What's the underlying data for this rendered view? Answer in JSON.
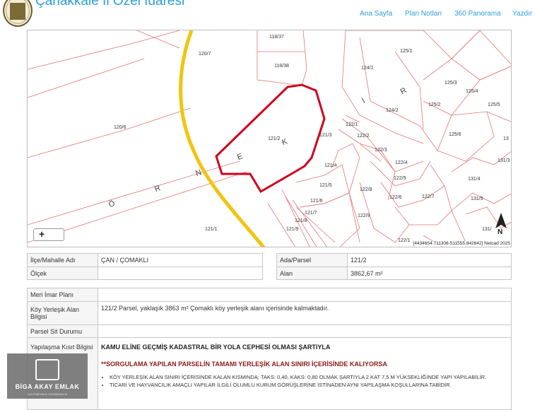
{
  "header": {
    "site_title": "Çanakkale İl Özel İdaresi",
    "nav": [
      "Ana Sayfa",
      "Plan Notları",
      "360 Panorama",
      "Yazdır"
    ]
  },
  "map": {
    "parcel_labels": [
      "118/37",
      "118/38",
      "120/7",
      "120/6",
      "125/1",
      "124/1",
      "125/3",
      "125/4",
      "125/2",
      "125/5",
      "124/2",
      "121/2",
      "121/3",
      "122/1",
      "122/2",
      "122/3",
      "122/4",
      "122/5",
      "121/4",
      "121/5",
      "121/6",
      "121/7",
      "121/8",
      "121/9",
      "121/1",
      "122/6",
      "122/7",
      "122/8",
      "122/9",
      "131/4",
      "131/5",
      "131/3",
      "125/6",
      "13",
      "131/",
      "122/1"
    ],
    "road_letters": [
      "Ö",
      "R",
      "N",
      "E",
      "K",
      "İ",
      "R"
    ],
    "zoom_in": "+",
    "coords": "[4434654.711308-511555.842642] Netcad 2025",
    "north_label": "N",
    "parcel_highlight_color": "#d0021b",
    "road_color": "#f2c40f",
    "parcel_line_color": "#e57373"
  },
  "info_left": {
    "district_label": "İlçe/Mahalle Adı",
    "district_value": "ÇAN / ÇOMAKLI",
    "scale_label": "Ölçek",
    "scale_value": ""
  },
  "info_right": {
    "parcel_label": "Ada/Parsel",
    "parcel_value": "121/2",
    "area_label": "Alan",
    "area_value": "3862,67 m²"
  },
  "plan": {
    "meri_label": "Meri İmar Planı",
    "meri_value": "",
    "koy_label": "Köy Yerleşik Alan Bilgisi",
    "koy_value": "121/2 Parsel, yaklaşık 3863 m² Çomaklı köy yerleşik alanı içerisinde kalmaktadır.",
    "sit_label": "Parsel Sit Durumu",
    "sit_value": "",
    "kisit_label": "Yapılaşma Kısıt Bilgisi",
    "kisit_title": "KAMU ELİNE GEÇMİŞ KADASTRAL BİR YOLA CEPHESİ OLMASI ŞARTIYLA",
    "kisit_warning": "**SORGULAMA YAPILAN PARSELİN TAMAMI YERLEŞİK ALAN SINIRI İÇERİSİNDE KALIYORSA",
    "kisit_notes": [
      "KÖY YERLEŞİK ALAN SINIRI İÇERİSİNDE KALAN KISMINDA; TAKS: 0,40, KAKS: 0,80 OLMAK ŞARTIYLA 2 KAT 7,5 M YÜKSEKLİĞİNDE YAPI YAPILABİLİR.",
      "TİCARİ VE HAYVANCILIK AMAÇLI YAPILAR İLGİLİ OLUMLU KURUM GÖRÜŞLERİNE İSTİNADEN AYNI YAPILAŞMA KOŞULLARINA TABİDİR."
    ]
  },
  "watermark": {
    "text": "BİGA AKAY EMLAK",
    "sub": "GAYRİMENKUL DANIŞMANLIK"
  }
}
